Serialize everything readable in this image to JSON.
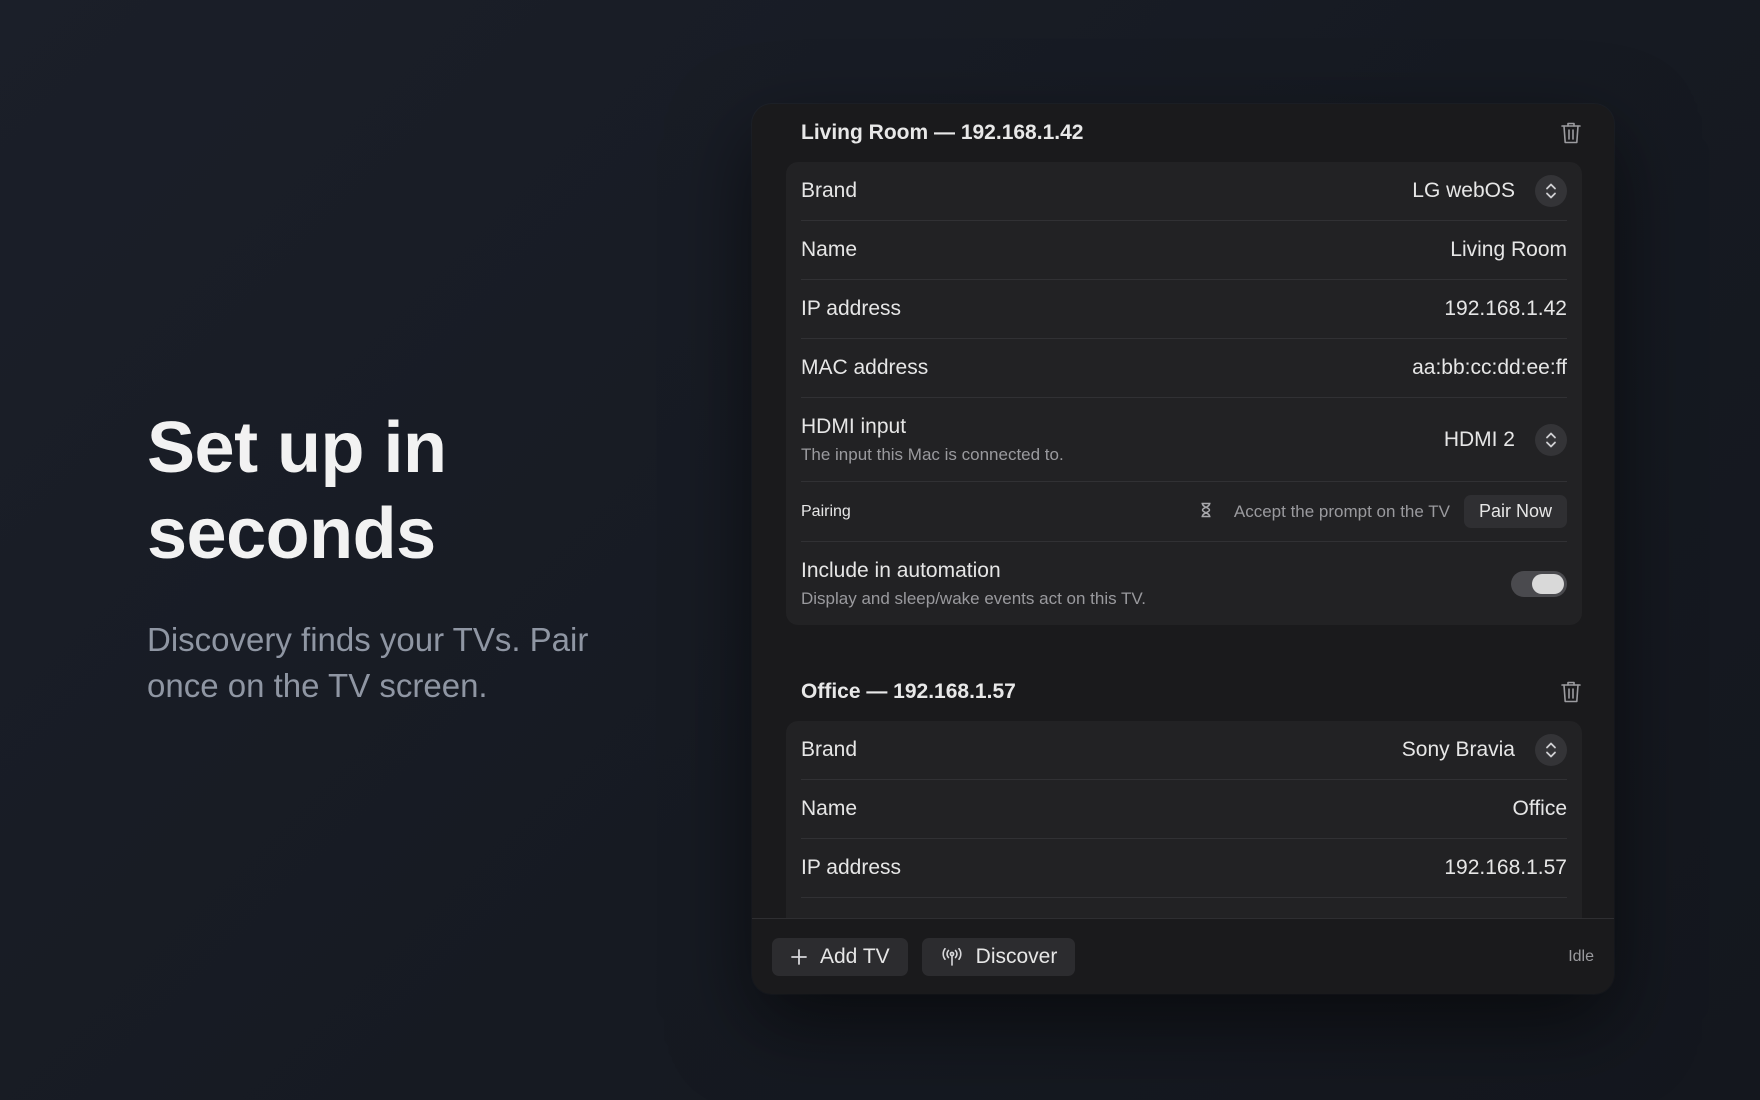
{
  "hero": {
    "title_line1": "Set up in",
    "title_line2": "seconds",
    "subtitle_line1": "Discovery finds your TVs. Pair",
    "subtitle_line2": "once on the TV screen."
  },
  "tvs": [
    {
      "title": "Living Room — 192.168.1.42",
      "brand_label": "Brand",
      "brand_value": "LG webOS",
      "name_label": "Name",
      "name_value": "Living Room",
      "ip_label": "IP address",
      "ip_value": "192.168.1.42",
      "mac_label": "MAC address",
      "mac_value": "aa:bb:cc:dd:ee:ff",
      "hdmi_label": "HDMI input",
      "hdmi_sub": "The input this Mac is connected to.",
      "hdmi_value": "HDMI 2",
      "pairing_label": "Pairing",
      "pairing_status": "Accept the prompt on the TV",
      "pair_button": "Pair Now",
      "automation_label": "Include in automation",
      "automation_sub": "Display and sleep/wake events act on this TV.",
      "automation_enabled": true
    },
    {
      "title": "Office — 192.168.1.57",
      "brand_label": "Brand",
      "brand_value": "Sony Bravia",
      "name_label": "Name",
      "name_value": "Office",
      "ip_label": "IP address",
      "ip_value": "192.168.1.57"
    }
  ],
  "footer": {
    "add_label": "Add TV",
    "discover_label": "Discover",
    "status": "Idle"
  },
  "icons": {
    "trash": "trash-icon",
    "stepper": "chevron-up-down-icon",
    "hourglass": "hourglass-icon",
    "plus": "plus-icon",
    "discover": "antenna-icon"
  },
  "colors": {
    "background": "#181c24",
    "panel": "#1a1a1c",
    "group": "#222224",
    "text": "#e6e6e6",
    "muted": "#9a9a9e",
    "hero_subtitle": "#8f96a3"
  }
}
